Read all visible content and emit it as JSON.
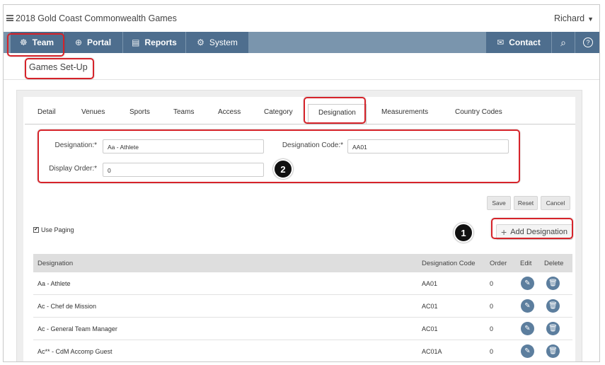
{
  "titlebar": {
    "app_title": "2018 Gold Coast Commonwealth Games",
    "user_name": "Richard",
    "user_caret": "▼"
  },
  "navbar": {
    "team": {
      "label": "Team",
      "icon": "☸"
    },
    "portal": {
      "label": "Portal",
      "icon": "⊕"
    },
    "reports": {
      "label": "Reports",
      "icon": "▤"
    },
    "system": {
      "label": "System",
      "icon": "⚙"
    },
    "contact": {
      "label": "Contact",
      "icon": "✉"
    },
    "search_icon": "⌕",
    "help_icon": "?"
  },
  "subbar": {
    "page_title": "Games Set-Up"
  },
  "tabs": [
    "Detail",
    "Venues",
    "Sports",
    "Teams",
    "Access",
    "Category",
    "Designation",
    "Measurements",
    "Country Codes"
  ],
  "active_tab": "Designation",
  "form": {
    "designation_label": "Designation:*",
    "designation_value": "Aa - Athlete",
    "code_label": "Designation Code:*",
    "code_value": "AA01",
    "order_label": "Display Order:*",
    "order_value": "0"
  },
  "buttons": {
    "save": "Save",
    "reset": "Reset",
    "cancel": "Cancel",
    "add": "Add Designation",
    "add_icon": "+"
  },
  "paging": {
    "label": "Use Paging",
    "checked": true,
    "check_glyph": "✔"
  },
  "markers": {
    "one": "1",
    "two": "2"
  },
  "table": {
    "headers": [
      "Designation",
      "Designation Code",
      "Order",
      "Edit",
      "Delete"
    ],
    "rows": [
      {
        "designation": "Aa - Athlete",
        "code": "AA01",
        "order": "0"
      },
      {
        "designation": "Ac - Chef de Mission",
        "code": "AC01",
        "order": "0"
      },
      {
        "designation": "Ac - General Team Manager",
        "code": "AC01",
        "order": "0"
      },
      {
        "designation": "Ac** - CdM Accomp Guest",
        "code": "AC01A",
        "order": "0"
      }
    ],
    "edit_icon": "✎",
    "delete_icon": "🗑"
  },
  "colors": {
    "nav_bg": "#7a95ad",
    "nav_button": "#4e6e8e",
    "callout_red": "#d6232a",
    "action_blue": "#5c7e9e"
  }
}
